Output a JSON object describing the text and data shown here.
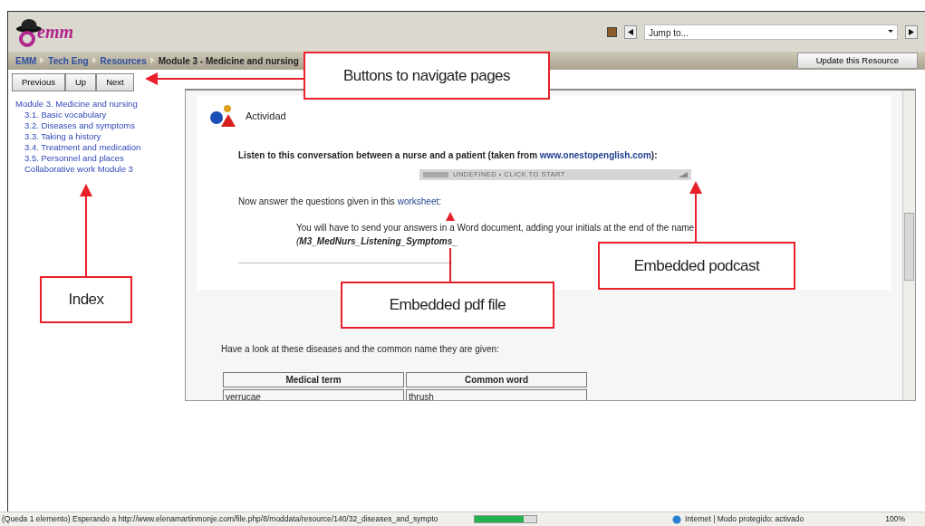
{
  "header": {
    "logo": "emm",
    "jump_to": "Jump to..."
  },
  "breadcrumb": [
    {
      "label": "EMM",
      "link": true
    },
    {
      "label": "Tech Eng",
      "link": true
    },
    {
      "label": "Resources",
      "link": true
    },
    {
      "label": "Module 3 - Medicine and nursing",
      "link": false
    }
  ],
  "update_button": "Update this Resource",
  "nav_buttons": [
    "Previous",
    "Up",
    "Next"
  ],
  "index": [
    {
      "label": "Module 3. Medicine and nursing",
      "children": [
        {
          "label": "3.1. Basic vocabulary"
        },
        {
          "label": "3.2. Diseases and symptoms"
        },
        {
          "label": "3.3. Taking a history"
        },
        {
          "label": "3.4. Treatment and medication"
        },
        {
          "label": "3.5. Personnel and places"
        },
        {
          "label": "Collaborative work Module 3"
        }
      ]
    }
  ],
  "activity": {
    "title": "Actividad",
    "intro": "Listen to this conversation between a nurse and a patient (taken from",
    "intro_link": "www.onestopenglish.com",
    "intro_end": "):",
    "player_label": "UNDEFINED • CLICK TO START",
    "question": "Now answer the questions given in this",
    "question_link": "worksheet",
    "question_end": ":",
    "instruction": "You will have to send your answers in a Word document, adding your initials at the end of the name",
    "filename": "(**M3_MedNurs_Listening_Symptoms_**"
  },
  "section": {
    "intro": "Have a look at these diseases and the common name they are given:",
    "table": {
      "columns": [
        "Medical term",
        "Common word"
      ],
      "rows": [
        [
          "verrucae",
          "thrush"
        ]
      ]
    }
  },
  "status_bar": {
    "text": "(Queda 1 elemento) Esperando a http://www.elenamartinmonje.com/file.php/8/moddata/resource/140/32_diseases_and_sympto",
    "level": 0.8,
    "zone": "Internet | Modo protegido: activado",
    "zoom": "100%"
  },
  "callouts": [
    {
      "text": "Buttons to navigate pages"
    },
    {
      "text": "Index"
    },
    {
      "text": "Embedded pdf file"
    },
    {
      "text": "Embedded podcast"
    }
  ]
}
